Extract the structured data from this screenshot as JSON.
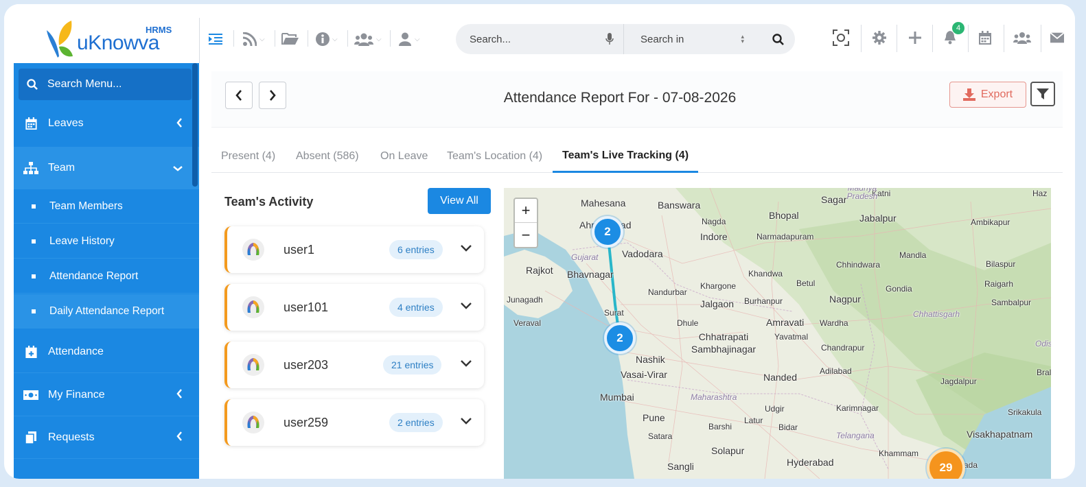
{
  "app": {
    "logo_name": "uKnowva",
    "logo_tag": "HRMS"
  },
  "topbar": {
    "search_placeholder": "Search...",
    "search_in_label": "Search in",
    "notification_count": "4",
    "icons": [
      "indent-icon",
      "rss-icon",
      "folder-icon",
      "info-icon",
      "users-icon",
      "user-icon",
      "face-scan-icon",
      "gear-icon",
      "plus-icon",
      "bell-icon",
      "calendar-icon",
      "team-icon",
      "mail-icon"
    ]
  },
  "sidebar": {
    "search_label": "Search Menu...",
    "items": [
      {
        "label": "Leaves"
      },
      {
        "label": "Team"
      },
      {
        "label": "Attendance"
      },
      {
        "label": "My Finance"
      },
      {
        "label": "Requests"
      }
    ],
    "team_sub": [
      {
        "label": "Team Members"
      },
      {
        "label": "Leave History"
      },
      {
        "label": "Attendance Report"
      },
      {
        "label": "Daily Attendance Report"
      }
    ]
  },
  "report": {
    "title": "Attendance Report For - 07-08-2026",
    "export_label": "Export"
  },
  "tabs": [
    {
      "label": "Present (4)"
    },
    {
      "label": "Absent (586)"
    },
    {
      "label": "On Leave"
    },
    {
      "label": "Team's Location (4)"
    },
    {
      "label": "Team's Live Tracking (4)"
    }
  ],
  "activity": {
    "title": "Team's Activity",
    "view_all_label": "View All",
    "users": [
      {
        "name": "user1",
        "entries": "6 entries"
      },
      {
        "name": "user101",
        "entries": "4 entries"
      },
      {
        "name": "user203",
        "entries": "21 entries"
      },
      {
        "name": "user259",
        "entries": "2 entries"
      }
    ]
  },
  "map": {
    "zoom_in": "+",
    "zoom_out": "−",
    "clusters": [
      "2",
      "2",
      "29"
    ],
    "cities": [
      "Mahesana",
      "Banswara",
      "Sagar",
      "Katni",
      "Haz",
      "Madhya Pradesh",
      "Nagda",
      "Bhopal",
      "Jabalpur",
      "Ambikapur",
      "Ahmedabad",
      "Indore",
      "Narmadapuram",
      "Vadodara",
      "Mandla",
      "Bilaspur",
      "Gujarat",
      "Rajkot",
      "Bhavnagar",
      "Khandwa",
      "Betul",
      "Chhindwara",
      "Khargone",
      "Gondia",
      "Raigarh",
      "Nandurbar",
      "Junagadh",
      "Jalgaon",
      "Burhanpur",
      "Nagpur",
      "Sambalpur",
      "Surat",
      "Veraval",
      "Dhule",
      "Amravati",
      "Wardha",
      "Chhattisgarh",
      "Chhatrapati Sambhajinagar",
      "Yavatmal",
      "Odis",
      "Chandrapur",
      "Nashik",
      "Adilabad",
      "Bral",
      "Vasai-Virar",
      "Nanded",
      "Jagdalpur",
      "Mumbai",
      "Maharashtra",
      "Udgir",
      "Karimnagar",
      "Pune",
      "Latur",
      "Srikakula",
      "Barshi",
      "Bidar",
      "Satara",
      "Telangana",
      "Visakhapatnam",
      "Solapur",
      "Khammam",
      "Hyderabad",
      "Sangli",
      "ada"
    ]
  }
}
